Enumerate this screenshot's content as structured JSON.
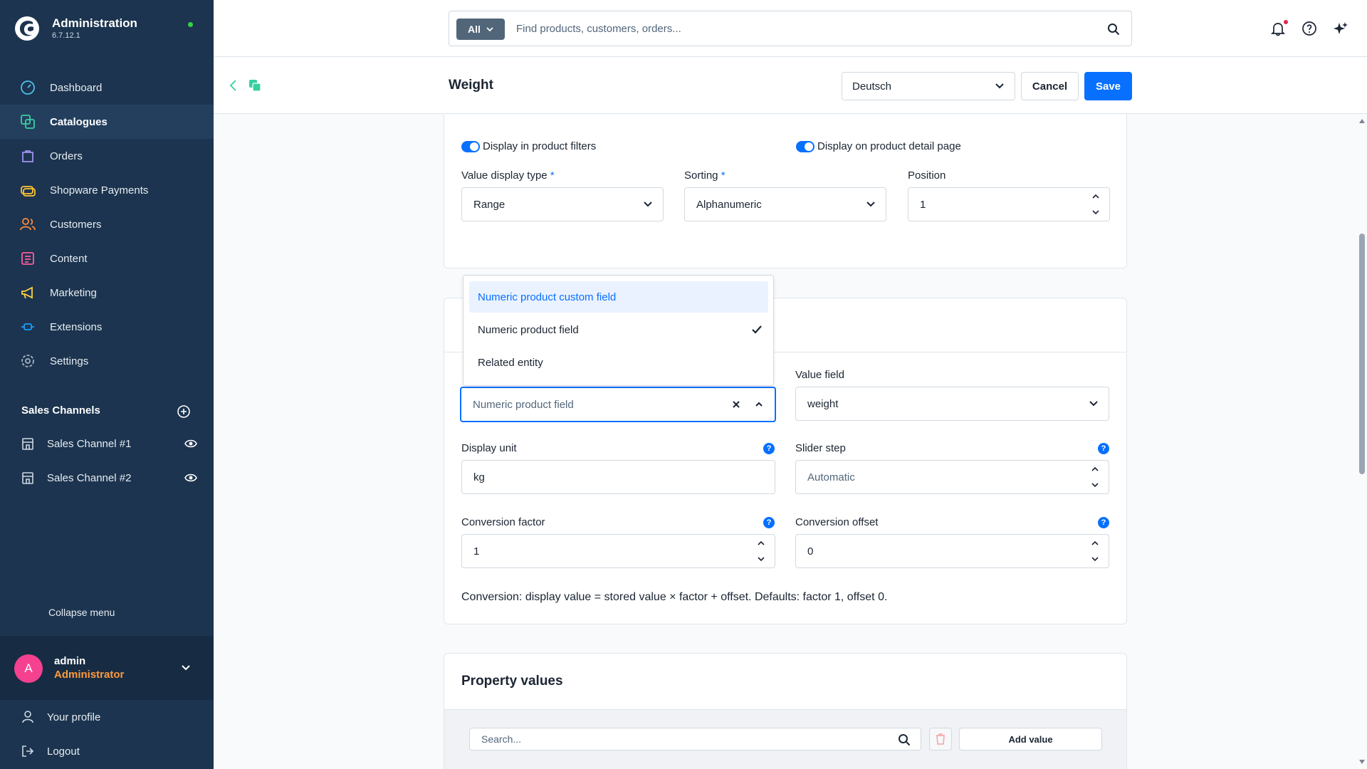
{
  "sidebar": {
    "brand_title": "Administration",
    "brand_version": "6.7.12.1",
    "nav": [
      {
        "label": "Dashboard",
        "icon": "dashboard-icon",
        "active": false
      },
      {
        "label": "Catalogues",
        "icon": "catalogues-icon",
        "active": true
      },
      {
        "label": "Orders",
        "icon": "orders-icon",
        "active": false
      },
      {
        "label": "Shopware Payments",
        "icon": "payments-icon",
        "active": false
      },
      {
        "label": "Customers",
        "icon": "customers-icon",
        "active": false
      },
      {
        "label": "Content",
        "icon": "content-icon",
        "active": false
      },
      {
        "label": "Marketing",
        "icon": "marketing-icon",
        "active": false
      },
      {
        "label": "Extensions",
        "icon": "extensions-icon",
        "active": false
      },
      {
        "label": "Settings",
        "icon": "settings-icon",
        "active": false
      }
    ],
    "sales_channels_title": "Sales Channels",
    "sales_channels": [
      {
        "label": "Sales Channel #1"
      },
      {
        "label": "Sales Channel #2"
      }
    ],
    "collapse_label": "Collapse menu",
    "user": {
      "initial": "A",
      "name": "admin",
      "role": "Administrator"
    },
    "profile_label": "Your profile",
    "logout_label": "Logout"
  },
  "topbar": {
    "search_scope": "All",
    "search_placeholder": "Find products, customers, orders..."
  },
  "smartbar": {
    "title": "Weight",
    "language": "Deutsch",
    "cancel_label": "Cancel",
    "save_label": "Save"
  },
  "display_card": {
    "toggle_filters_label": "Display in product filters",
    "toggle_detail_label": "Display on product detail page",
    "value_display_type": {
      "label": "Value display type",
      "value": "Range"
    },
    "sorting": {
      "label": "Sorting",
      "value": "Alphanumeric"
    },
    "position": {
      "label": "Position",
      "value": "1"
    }
  },
  "source_card": {
    "source_dropdown": {
      "options": [
        {
          "label": "Numeric product custom field",
          "hover": true,
          "selected": false
        },
        {
          "label": "Numeric product field",
          "hover": false,
          "selected": true
        },
        {
          "label": "Related entity",
          "hover": false,
          "selected": false
        }
      ],
      "current_value": "Numeric product field"
    },
    "value_field": {
      "label": "Value field",
      "value": "weight"
    },
    "display_unit": {
      "label": "Display unit",
      "value": "kg"
    },
    "slider_step": {
      "label": "Slider step",
      "placeholder": "Automatic"
    },
    "conversion_factor": {
      "label": "Conversion factor",
      "value": "1"
    },
    "conversion_offset": {
      "label": "Conversion offset",
      "value": "0"
    },
    "hint": "Conversion: display value = stored value × factor + offset. Defaults: factor 1, offset 0."
  },
  "property_values": {
    "title": "Property values",
    "search_placeholder": "Search...",
    "add_label": "Add value"
  },
  "colors": {
    "sidebar_bg": "#1c344f",
    "accent": "#0870ff",
    "avatar": "#f5418f",
    "role": "#ff9a3c",
    "status_online": "#37d046"
  }
}
